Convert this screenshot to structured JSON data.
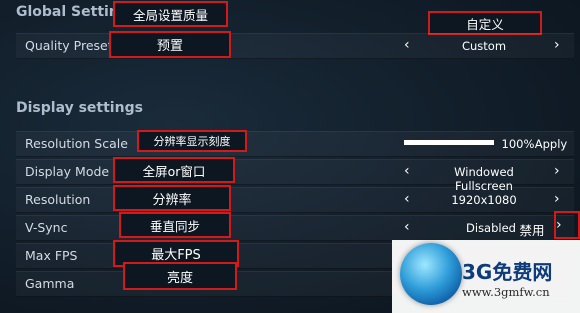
{
  "global": {
    "title": "Global Settings",
    "title_annotation": "全局设置质量",
    "custom_annotation": "自定义",
    "quality_preset": {
      "label": "Quality Preset",
      "annotation": "预置",
      "value": "Custom"
    }
  },
  "display": {
    "title": "Display settings",
    "resolution_scale": {
      "label": "Resolution Scale",
      "annotation": "分辨率显示刻度",
      "percent_text": "100%",
      "value": 100,
      "apply": "Apply"
    },
    "display_mode": {
      "label": "Display Mode",
      "annotation": "全屏or窗口",
      "value": "Windowed Fullscreen"
    },
    "resolution": {
      "label": "Resolution",
      "annotation": "分辨率",
      "value": "1920x1080"
    },
    "vsync": {
      "label": "V-Sync",
      "annotation": "垂直同步",
      "value": "Disabled",
      "value_annotation": "禁用"
    },
    "max_fps": {
      "label": "Max FPS",
      "annotation": "最大FPS"
    },
    "gamma": {
      "label": "Gamma",
      "annotation": "亮度"
    }
  },
  "arrows": {
    "left": "‹",
    "right": "›"
  },
  "watermark": {
    "title": "3G免费网",
    "url": "www.3gmfw.cn"
  },
  "colors": {
    "annotation_border": "#d21a1a",
    "background": "#111e2a"
  }
}
